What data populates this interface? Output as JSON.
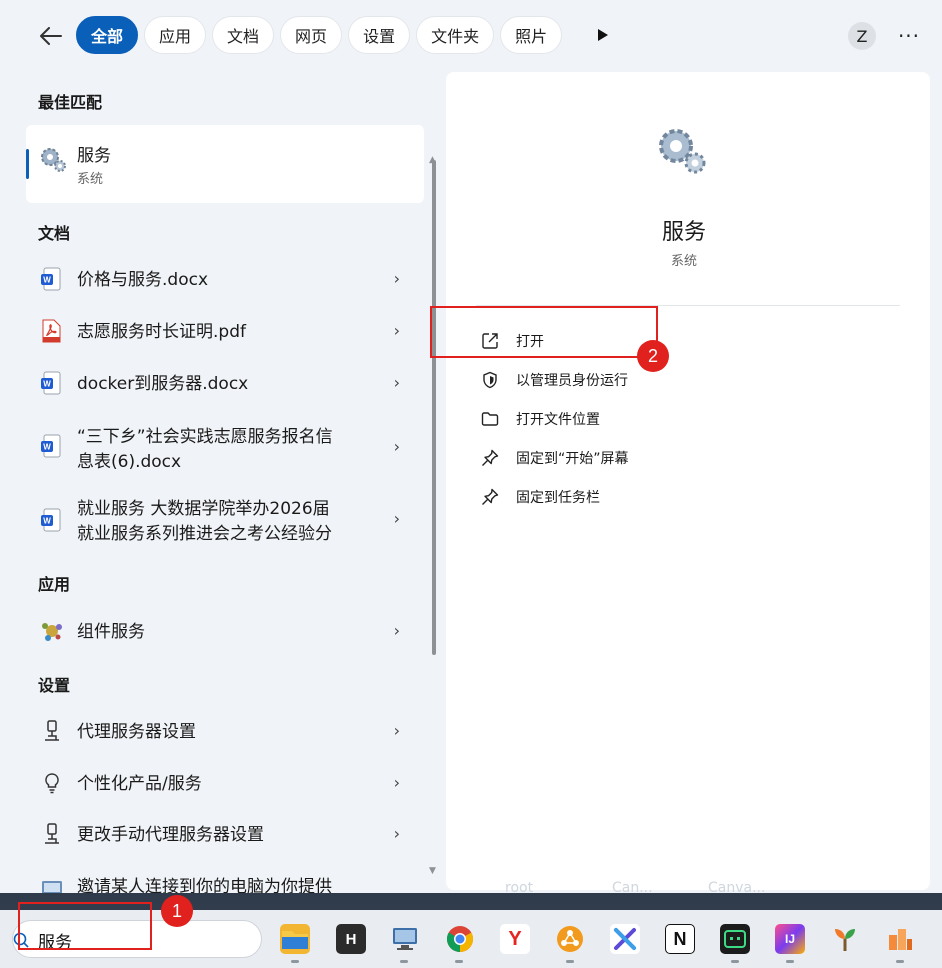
{
  "tabs": {
    "back_label": "←",
    "items": [
      {
        "label": "全部",
        "active": true
      },
      {
        "label": "应用",
        "active": false
      },
      {
        "label": "文档",
        "active": false
      },
      {
        "label": "网页",
        "active": false
      },
      {
        "label": "设置",
        "active": false
      },
      {
        "label": "文件夹",
        "active": false
      },
      {
        "label": "照片",
        "active": false
      }
    ],
    "more_tabs_icon": "play-triangle-icon",
    "avatar_letter": "Z",
    "more_label": "···"
  },
  "best_match": {
    "section": "最佳匹配",
    "name": "服务",
    "sub": "系统",
    "icon": "gears-icon"
  },
  "documents": {
    "section": "文档",
    "items": [
      {
        "label": "价格与服务.docx",
        "icon": "word-doc-icon"
      },
      {
        "label": "志愿服务时长证明.pdf",
        "icon": "pdf-doc-icon"
      },
      {
        "label": "docker到服务器.docx",
        "icon": "word-doc-icon"
      },
      {
        "label_line1": "“三下乡”社会实践志愿服务报名信",
        "label_line2": "息表(6).docx",
        "icon": "word-doc-icon"
      },
      {
        "label_line1": "就业服务 大数据学院举办2026届",
        "label_line2": "就业服务系列推进会之考公经验分",
        "icon": "word-doc-icon"
      }
    ]
  },
  "apps": {
    "section": "应用",
    "items": [
      {
        "label": "组件服务",
        "icon": "component-services-icon"
      }
    ]
  },
  "settings": {
    "section": "设置",
    "items": [
      {
        "label": "代理服务器设置",
        "icon": "proxy-icon"
      },
      {
        "label": "个性化产品/服务",
        "icon": "lightbulb-icon"
      },
      {
        "label": "更改手动代理服务器设置",
        "icon": "proxy-icon"
      },
      {
        "label": "邀请某人连接到你的电脑为你提供",
        "icon": "remote-assist-icon"
      }
    ]
  },
  "chevron": "›",
  "detail": {
    "title": "服务",
    "sub": "系统",
    "actions": [
      {
        "label": "打开",
        "icon": "open-external-icon"
      },
      {
        "label": "以管理员身份运行",
        "icon": "shield-icon"
      },
      {
        "label": "打开文件位置",
        "icon": "folder-icon"
      },
      {
        "label": "固定到“开始”屏幕",
        "icon": "pin-icon"
      },
      {
        "label": "固定到任务栏",
        "icon": "pin-icon"
      }
    ]
  },
  "annotations": {
    "one": "1",
    "two": "2"
  },
  "background_peek": {
    "crumb1": "root",
    "crumb2": "Can...",
    "crumb3": "Canva..."
  },
  "taskbar": {
    "search_value": "服务",
    "apps": [
      {
        "name": "file-explorer-icon",
        "color": "#f2b632"
      },
      {
        "name": "h-app-icon",
        "color": "#2b2b2b",
        "text": "H"
      },
      {
        "name": "remote-desktop-icon",
        "color": "#3d6fa8"
      },
      {
        "name": "chrome-icon",
        "color": "#4285f4"
      },
      {
        "name": "yandex-icon",
        "color": "#ffffff",
        "text": "Y"
      },
      {
        "name": "network-app-icon",
        "color": "#f29a1d"
      },
      {
        "name": "cursor-icon",
        "color": "#ffffff"
      },
      {
        "name": "notion-icon",
        "color": "#ffffff",
        "text": "N"
      },
      {
        "name": "terminal-app-icon",
        "color": "#1c1c1c"
      },
      {
        "name": "intellij-icon",
        "color": "#ff4f8b",
        "text": "IJ"
      },
      {
        "name": "sprout-app-icon",
        "color": "#ffffff"
      },
      {
        "name": "office-app-icon",
        "color": "#f48a3a"
      }
    ]
  }
}
